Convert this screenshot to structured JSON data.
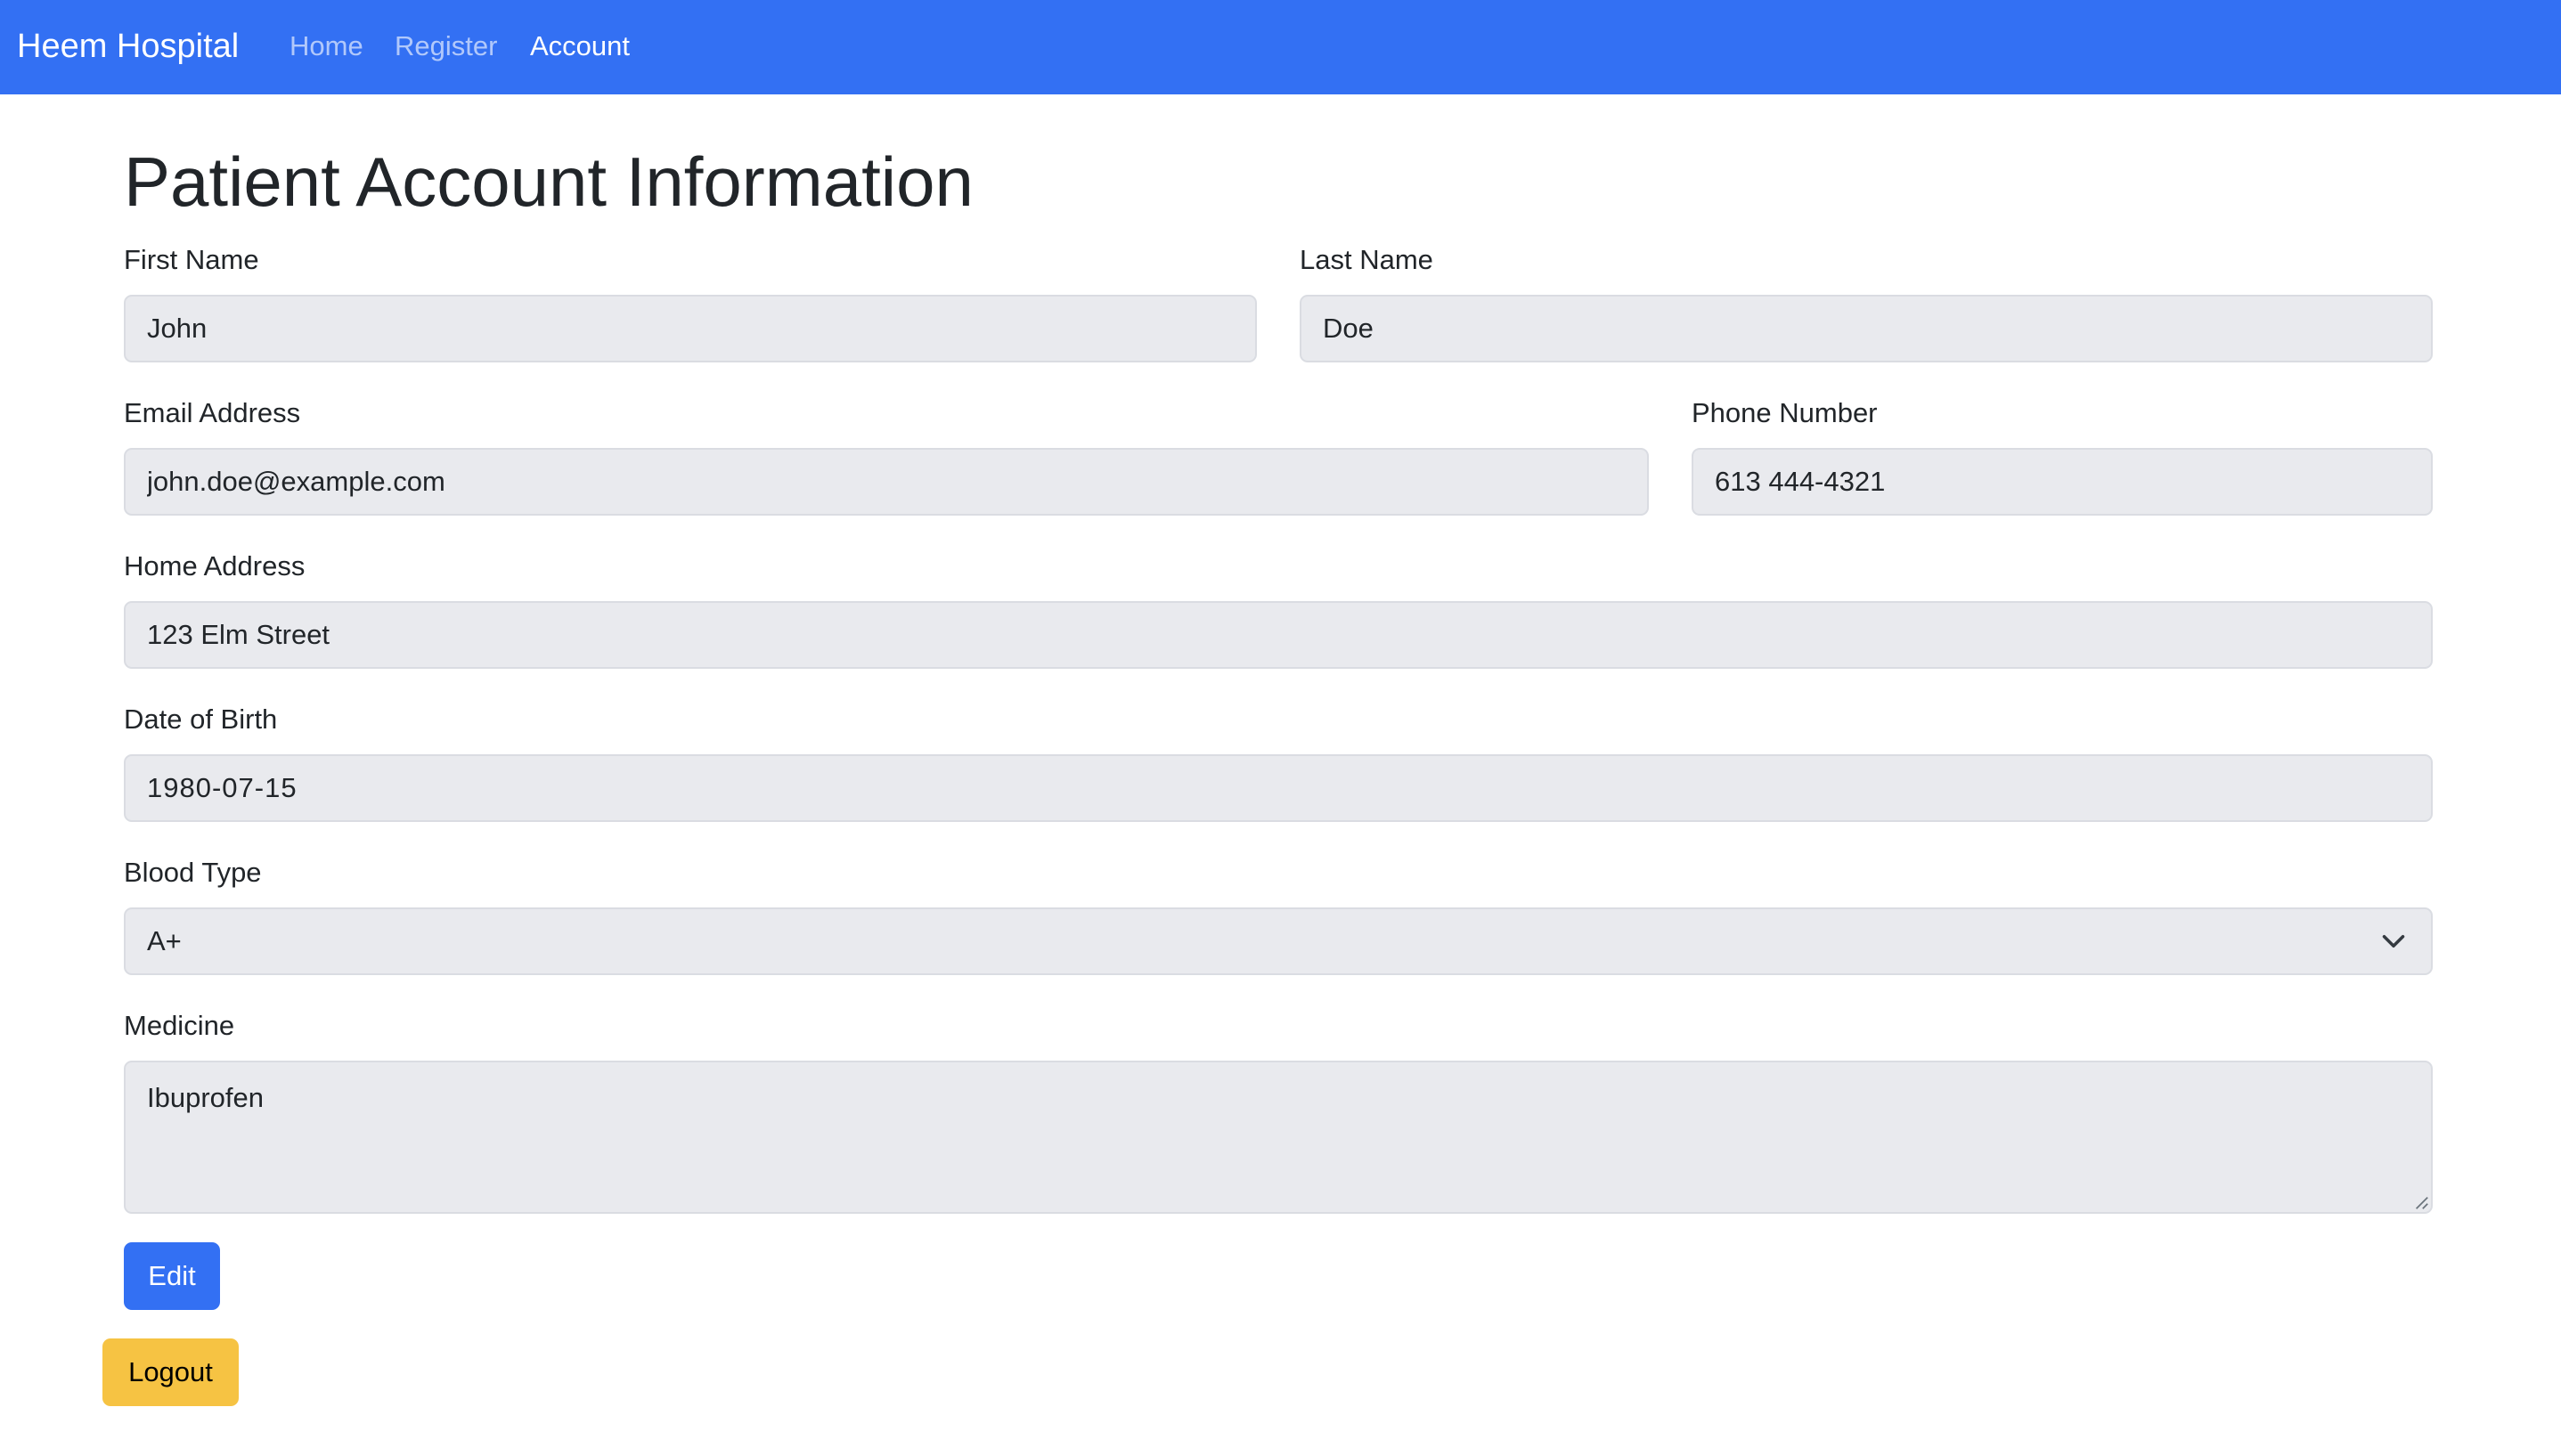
{
  "navbar": {
    "brand": "Heem Hospital",
    "links": [
      {
        "label": "Home",
        "active": false
      },
      {
        "label": "Register",
        "active": false
      },
      {
        "label": "Account",
        "active": true
      }
    ],
    "background_color": "#3370f3"
  },
  "page": {
    "title": "Patient Account Information"
  },
  "form": {
    "first_name": {
      "label": "First Name",
      "value": "John"
    },
    "last_name": {
      "label": "Last Name",
      "value": "Doe"
    },
    "email": {
      "label": "Email Address",
      "value": "john.doe@example.com"
    },
    "phone": {
      "label": "Phone Number",
      "value": "613 444-4321"
    },
    "address": {
      "label": "Home Address",
      "value": "123 Elm Street"
    },
    "dob": {
      "label": "Date of Birth",
      "value": "1980-07-15"
    },
    "blood_type": {
      "label": "Blood Type",
      "value": "A+",
      "icon": "chevron-down-icon"
    },
    "medicine": {
      "label": "Medicine",
      "value": "Ibuprofen"
    }
  },
  "actions": {
    "edit_label": "Edit",
    "edit_color": "#3370f3",
    "logout_label": "Logout",
    "logout_color": "#f6c343"
  }
}
